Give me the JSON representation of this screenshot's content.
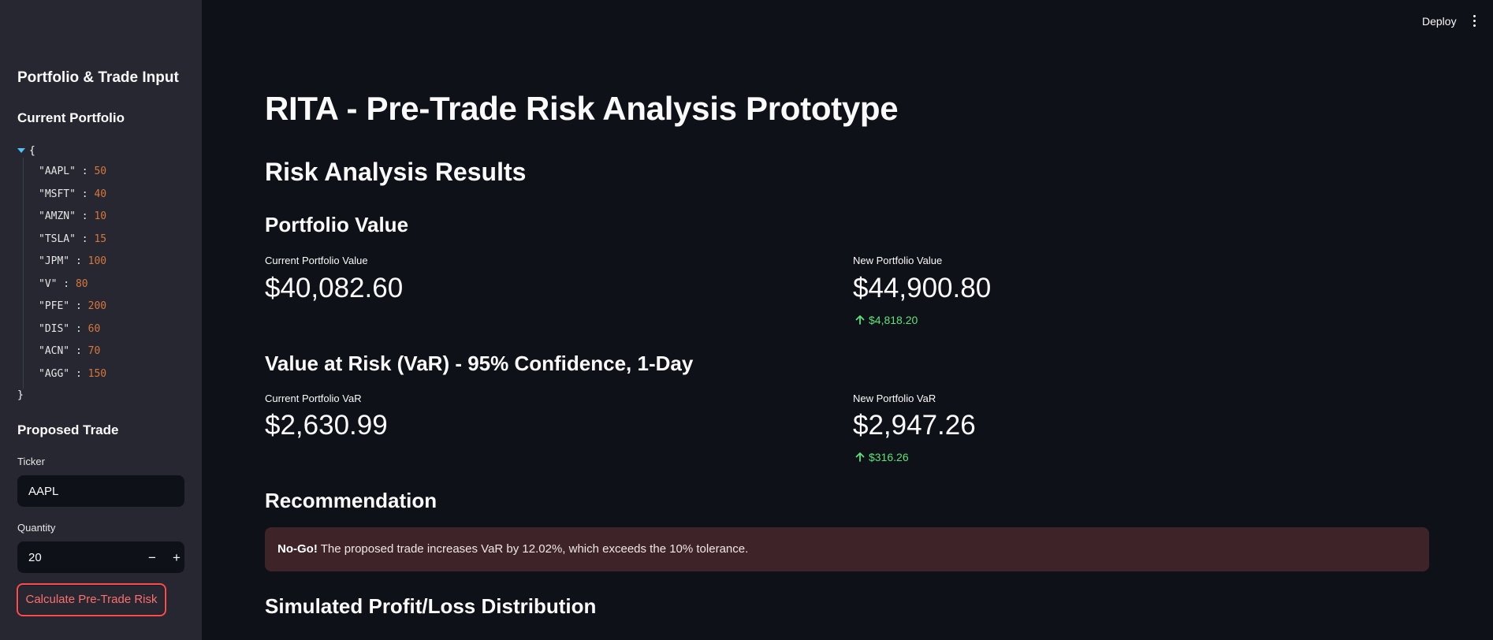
{
  "header": {
    "deploy_label": "Deploy"
  },
  "sidebar": {
    "title": "Portfolio & Trade Input",
    "portfolio_heading": "Current Portfolio",
    "json_open": "{",
    "json_close": "}",
    "portfolio": [
      {
        "key": "\"AAPL\"",
        "value": "50"
      },
      {
        "key": "\"MSFT\"",
        "value": "40"
      },
      {
        "key": "\"AMZN\"",
        "value": "10"
      },
      {
        "key": "\"TSLA\"",
        "value": "15"
      },
      {
        "key": "\"JPM\"",
        "value": "100"
      },
      {
        "key": "\"V\"",
        "value": "80"
      },
      {
        "key": "\"PFE\"",
        "value": "200"
      },
      {
        "key": "\"DIS\"",
        "value": "60"
      },
      {
        "key": "\"ACN\"",
        "value": "70"
      },
      {
        "key": "\"AGG\"",
        "value": "150"
      }
    ],
    "trade_heading": "Proposed Trade",
    "ticker_label": "Ticker",
    "ticker_value": "AAPL",
    "quantity_label": "Quantity",
    "quantity_value": "20",
    "minus_label": "−",
    "plus_label": "+",
    "calc_button": "Calculate Pre-Trade Risk"
  },
  "main": {
    "title": "RITA - Pre-Trade Risk Analysis Prototype",
    "results_heading": "Risk Analysis Results",
    "portfolio_value_heading": "Portfolio Value",
    "current_value_label": "Current Portfolio Value",
    "current_value": "$40,082.60",
    "new_value_label": "New Portfolio Value",
    "new_value": "$44,900.80",
    "new_value_delta": "$4,818.20",
    "var_heading": "Value at Risk (VaR) - 95% Confidence, 1-Day",
    "current_var_label": "Current Portfolio VaR",
    "current_var": "$2,630.99",
    "new_var_label": "New Portfolio VaR",
    "new_var": "$2,947.26",
    "new_var_delta": "$316.26",
    "recommendation_heading": "Recommendation",
    "alert_bold": "No-Go!",
    "alert_text": " The proposed trade increases VaR by 12.02%, which exceeds the 10% tolerance.",
    "distribution_heading": "Simulated Profit/Loss Distribution"
  },
  "colors": {
    "accent": "#ff4b4b",
    "positive_delta": "#5ce27a",
    "json_number": "#d7773d",
    "alert_bg": "#3e2428"
  }
}
